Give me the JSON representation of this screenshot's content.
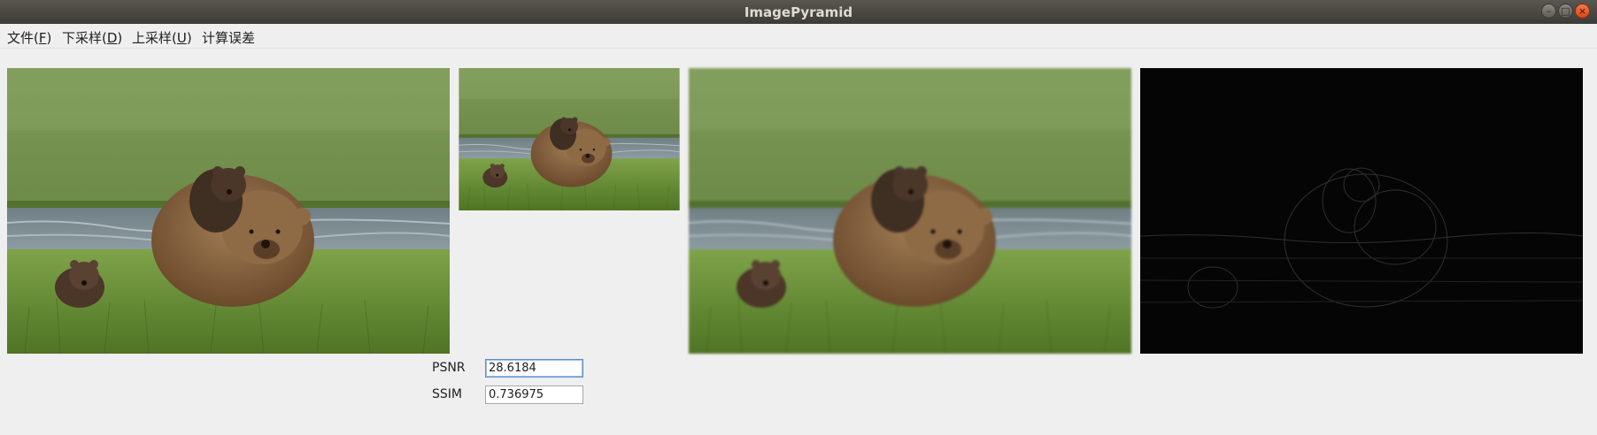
{
  "window": {
    "title": "ImagePyramid",
    "controls": {
      "minimize": "–",
      "maximize": "□",
      "close": "×"
    }
  },
  "menu": [
    {
      "label": "文件(",
      "mnemonic": "F",
      "suffix": ")"
    },
    {
      "label": "下采样(",
      "mnemonic": "D",
      "suffix": ")"
    },
    {
      "label": "上采样(",
      "mnemonic": "U",
      "suffix": ")"
    },
    {
      "label": "计算误差",
      "mnemonic": "",
      "suffix": ""
    }
  ],
  "images": {
    "original": "original-bear-image",
    "downsampled": "downsampled-bear-image",
    "upsampled": "upsampled-bear-image",
    "difference": "error-difference-image"
  },
  "metrics": {
    "psnr_label": "PSNR",
    "psnr_value": "28.6184",
    "ssim_label": "SSIM",
    "ssim_value": "0.736975"
  },
  "colors": {
    "titlebar": "#3c3b37",
    "grass": "#6f8f3e",
    "water": "#7a8a94",
    "bear_brown": "#8a6440",
    "cub_dark": "#3f2e22",
    "difference_bg": "#050505"
  }
}
